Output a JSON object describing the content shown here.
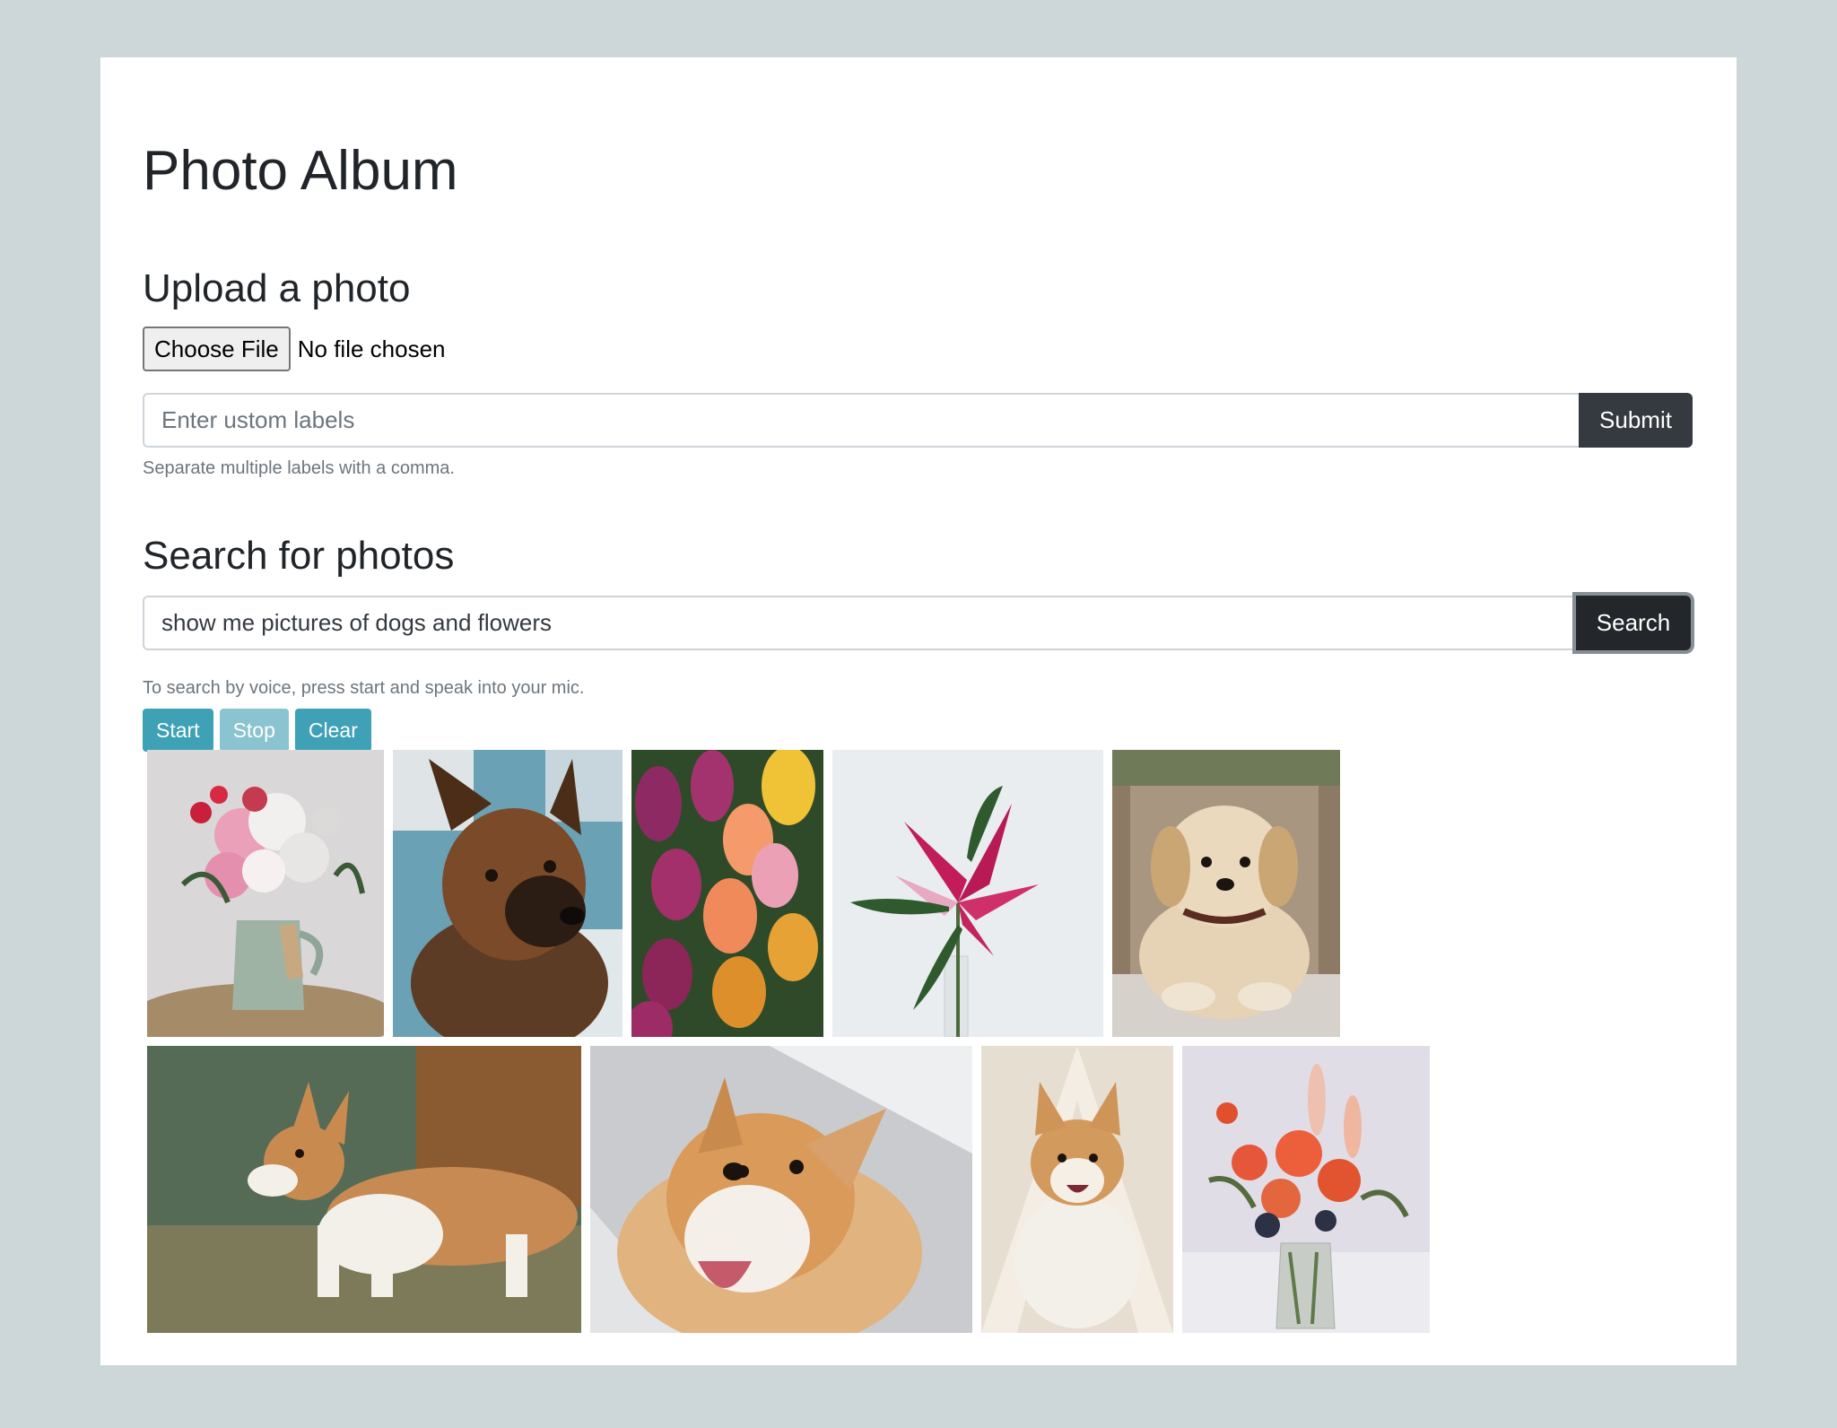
{
  "title": "Photo Album",
  "upload": {
    "heading": "Upload a photo",
    "choose_file_label": "Choose File",
    "no_file_text": "No file chosen",
    "labels_placeholder": "Enter ustom labels",
    "submit_label": "Submit",
    "help_text": "Separate multiple labels with a comma."
  },
  "search": {
    "heading": "Search for photos",
    "query_value": "show me pictures of dogs and flowers",
    "search_label": "Search",
    "voice_help": "To search by voice, press start and speak into your mic.",
    "start_label": "Start",
    "stop_label": "Stop",
    "clear_label": "Clear"
  },
  "photos": [
    {
      "subject": "flower bouquet in jug",
      "icon": "flowers-image"
    },
    {
      "subject": "german shepherd",
      "icon": "dog-image"
    },
    {
      "subject": "tulips",
      "icon": "flowers-image"
    },
    {
      "subject": "pink lily",
      "icon": "flower-image"
    },
    {
      "subject": "golden retriever puppy",
      "icon": "dog-image"
    },
    {
      "subject": "corgi in grass",
      "icon": "dog-image"
    },
    {
      "subject": "corgi close up",
      "icon": "dog-image"
    },
    {
      "subject": "corgi in tent",
      "icon": "dog-image"
    },
    {
      "subject": "orange flower bouquet",
      "icon": "flowers-image"
    }
  ],
  "colors": {
    "background": "#cdd7da",
    "dark_button": "#343a40",
    "info_button": "#3ea1b6"
  }
}
